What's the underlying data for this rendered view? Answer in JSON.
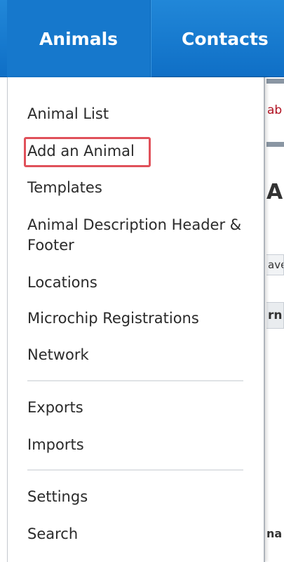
{
  "nav": {
    "tabs": [
      {
        "label": "Animals",
        "active": true
      },
      {
        "label": "Contacts",
        "active": false
      }
    ],
    "bar_color": "#1678cc"
  },
  "menu": {
    "items": [
      {
        "label": "Animal List"
      },
      {
        "label": "Add an Animal",
        "highlighted": true
      },
      {
        "label": "Templates"
      },
      {
        "label": "Animal Description Header & Footer"
      },
      {
        "label": "Locations"
      },
      {
        "label": "Microchip Registrations"
      },
      {
        "label": "Network"
      },
      {
        "label": "Exports"
      },
      {
        "label": "Imports"
      },
      {
        "label": "Settings"
      },
      {
        "label": "Search"
      }
    ],
    "highlight_color": "#e0515a"
  },
  "background": {
    "link_fragment": "ab",
    "heading_fragment": "Ar",
    "button_fragment": "ave",
    "section_fragment": "rn",
    "bottom_fragment": "na"
  }
}
